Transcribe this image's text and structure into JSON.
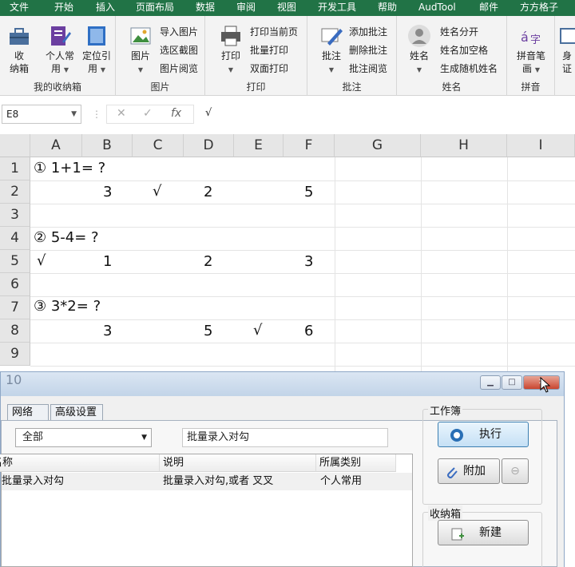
{
  "menu": {
    "tabs": [
      "文件",
      "开始",
      "插入",
      "页面布局",
      "数据",
      "审阅",
      "视图",
      "开发工具",
      "帮助",
      "AudTool",
      "邮件",
      "方方格子"
    ]
  },
  "ribbon": {
    "group1": {
      "label": "我的收纳箱",
      "btn_collect_1": "收",
      "btn_collect_2": "纳箱",
      "btn_personal_1": "个人常",
      "btn_personal_2": "用",
      "btn_locate_1": "定位引",
      "btn_locate_2": "用"
    },
    "group2": {
      "label": "图片",
      "btn_picture": "图片",
      "import": "导入图片",
      "screenshot": "选区截图",
      "browse": "图片阅览"
    },
    "group3": {
      "label": "打印",
      "btn_print": "打印",
      "print_current": "打印当前页",
      "batch_print": "批量打印",
      "duplex_print": "双面打印"
    },
    "group4": {
      "label": "批注",
      "btn_comment": "批注",
      "add": "添加批注",
      "delete": "删除批注",
      "browse": "批注阅览"
    },
    "group5": {
      "label": "姓名",
      "btn_name": "姓名",
      "split": "姓名分开",
      "space": "姓名加空格",
      "random": "生成随机姓名"
    },
    "group6": {
      "label": "拼音",
      "btn_pinyin_1": "拼音笔",
      "btn_pinyin_2": "画",
      "btn_next_1": "身",
      "btn_next_2": "证"
    }
  },
  "formula_bar": {
    "name_box": "E8",
    "formula": "√"
  },
  "sheet": {
    "columns": [
      "A",
      "B",
      "C",
      "D",
      "E",
      "F",
      "G",
      "H",
      "I"
    ],
    "rows": [
      "1",
      "2",
      "3",
      "4",
      "5",
      "6",
      "7",
      "8",
      "9"
    ],
    "cells": {
      "r1_a": "① 1+1= ?",
      "r2_b": "3",
      "r2_c": "√",
      "r2_d": "2",
      "r2_f": "5",
      "r4_a": "② 5-4= ?",
      "r5_a": "√",
      "r5_b": "1",
      "r5_d": "2",
      "r5_f": "3",
      "r7_a": "③ 3*2= ?",
      "r8_b": "3",
      "r8_d": "5",
      "r8_e": "√",
      "r8_f": "6"
    }
  },
  "dialog": {
    "behind_row": "10",
    "tabs": [
      "网络",
      "高级设置"
    ],
    "category_value": "全部",
    "search_value": "批量录入对勾",
    "list_headers": [
      "名称",
      "说明",
      "所属类别"
    ],
    "list_rows": [
      {
        "name": "批量录入对勾",
        "desc": "批量录入对勾,或者 叉叉",
        "category": "个人常用"
      }
    ],
    "workbook_label": "工作簿",
    "execute_label": "执行",
    "attach_label": "附加",
    "box_label": "收纳箱",
    "new_label": "新建"
  },
  "colors": {
    "excel_green": "#217346",
    "accent_blue": "#2a6fb5"
  }
}
